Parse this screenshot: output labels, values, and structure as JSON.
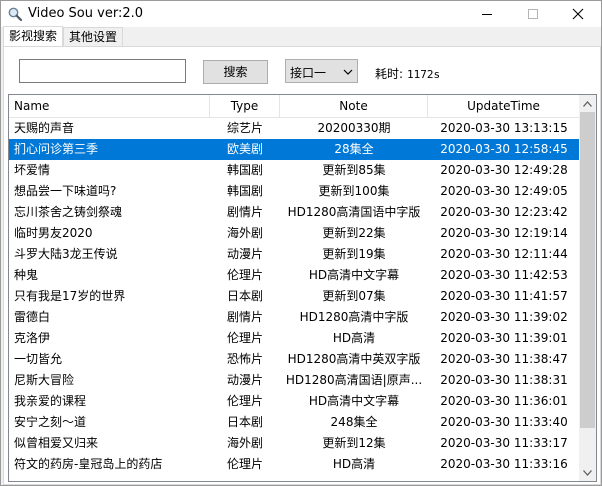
{
  "window": {
    "title": "Video Sou ver:2.0",
    "app_icon": "magnifier-icon",
    "controls": [
      "minimize-icon",
      "maximize-icon",
      "close-icon"
    ]
  },
  "tabs": [
    {
      "label": "影视搜索",
      "active": true
    },
    {
      "label": "其他设置",
      "active": false
    }
  ],
  "search": {
    "value": "",
    "placeholder": "",
    "button_label": "搜索"
  },
  "source_select": {
    "selected": "接口一",
    "arrow_icon": "chevron-down-icon"
  },
  "timing": {
    "label": "耗时:",
    "value": "1172s"
  },
  "table": {
    "columns": [
      "Name",
      "Type",
      "Note",
      "UpdateTime"
    ],
    "selected_index": 1,
    "rows": [
      {
        "name": "天赐的声音",
        "type": "综艺片",
        "note": "20200330期",
        "time": "2020-03-30 13:13:15"
      },
      {
        "name": "扪心问诊第三季",
        "type": "欧美剧",
        "note": "28集全",
        "time": "2020-03-30 12:58:45"
      },
      {
        "name": "坏爱情",
        "type": "韩国剧",
        "note": "更新到85集",
        "time": "2020-03-30 12:49:28"
      },
      {
        "name": "想品尝一下味道吗?",
        "type": "韩国剧",
        "note": "更新到100集",
        "time": "2020-03-30 12:49:05"
      },
      {
        "name": "忘川茶舍之铸剑祭魂",
        "type": "剧情片",
        "note": "HD1280高清国语中字版",
        "time": "2020-03-30 12:23:42"
      },
      {
        "name": "临时男友2020",
        "type": "海外剧",
        "note": "更新到22集",
        "time": "2020-03-30 12:19:14"
      },
      {
        "name": "斗罗大陆3龙王传说",
        "type": "动漫片",
        "note": "更新到19集",
        "time": "2020-03-30 12:11:44"
      },
      {
        "name": "种鬼",
        "type": "伦理片",
        "note": "HD高清中文字幕",
        "time": "2020-03-30 11:42:53"
      },
      {
        "name": "只有我是17岁的世界",
        "type": "日本剧",
        "note": "更新到07集",
        "time": "2020-03-30 11:41:57"
      },
      {
        "name": "雷德白",
        "type": "剧情片",
        "note": "HD1280高清中字版",
        "time": "2020-03-30 11:39:02"
      },
      {
        "name": "克洛伊",
        "type": "伦理片",
        "note": "HD高清",
        "time": "2020-03-30 11:39:01"
      },
      {
        "name": "一切皆允",
        "type": "恐怖片",
        "note": "HD1280高清中英双字版",
        "time": "2020-03-30 11:38:47"
      },
      {
        "name": "尼斯大冒险",
        "type": "动漫片",
        "note": "HD1280高清国语|原声...",
        "time": "2020-03-30 11:38:31"
      },
      {
        "name": "我亲爱的课程",
        "type": "伦理片",
        "note": "HD高清中文字幕",
        "time": "2020-03-30 11:36:01"
      },
      {
        "name": "安宁之刻～道",
        "type": "日本剧",
        "note": "248集全",
        "time": "2020-03-30 11:33:40"
      },
      {
        "name": "似曾相爱又归来",
        "type": "海外剧",
        "note": "更新到12集",
        "time": "2020-03-30 11:33:17"
      },
      {
        "name": "符文的药房-皇冠岛上的药店",
        "type": "伦理片",
        "note": "HD高清",
        "time": "2020-03-30 11:33:16"
      }
    ]
  },
  "scrollbar": {
    "up_icon": "scroll-up-arrow-icon",
    "down_icon": "scroll-down-arrow-icon"
  },
  "colors": {
    "selection": "#0078d7",
    "selection_text": "#ffffff",
    "window_bg": "#f0f0f0"
  }
}
